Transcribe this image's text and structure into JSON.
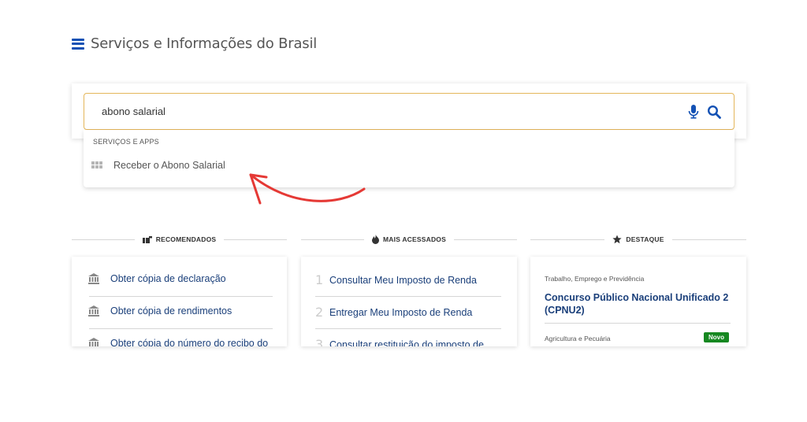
{
  "header": {
    "title": "Serviços e Informações do Brasil",
    "menu_icon": "hamburger-menu-icon"
  },
  "search": {
    "value": "abono salarial",
    "mic_icon": "microphone-icon",
    "search_icon": "search-icon"
  },
  "suggestions": {
    "heading": "SERVIÇOS E APPS",
    "items": [
      {
        "label": "Receber o Abono Salarial",
        "icon": "apps-grid-icon"
      }
    ]
  },
  "annotation": {
    "arrow_color": "#e53935"
  },
  "sections": [
    {
      "label": "RECOMENDADOS",
      "icon": "pointing-hand-icon",
      "items": [
        {
          "label": "Obter cópia de declaração",
          "icon": "bank-icon"
        },
        {
          "label": "Obter cópia de rendimentos",
          "icon": "bank-icon"
        },
        {
          "label": "Obter cópia do número do recibo do",
          "icon": "bank-icon"
        }
      ]
    },
    {
      "label": "MAIS ACESSADOS",
      "icon": "fire-icon",
      "items": [
        {
          "rank": "1",
          "label": "Consultar Meu Imposto de Renda"
        },
        {
          "rank": "2",
          "label": "Entregar Meu Imposto de Renda"
        },
        {
          "rank": "3",
          "label": "Consultar restituição do imposto de"
        }
      ]
    },
    {
      "label": "DESTAQUE",
      "icon": "star-icon",
      "items": [
        {
          "category": "Trabalho, Emprego e Previdência",
          "title": "Concurso Público Nacional Unificado 2 (CPNU2)"
        },
        {
          "category": "Agricultura e Pecuária",
          "badge": "Novo"
        }
      ]
    }
  ],
  "colors": {
    "primary": "#1351b4",
    "link": "#1a3f7a",
    "search_border": "#e4b65a",
    "badge": "#168821"
  }
}
